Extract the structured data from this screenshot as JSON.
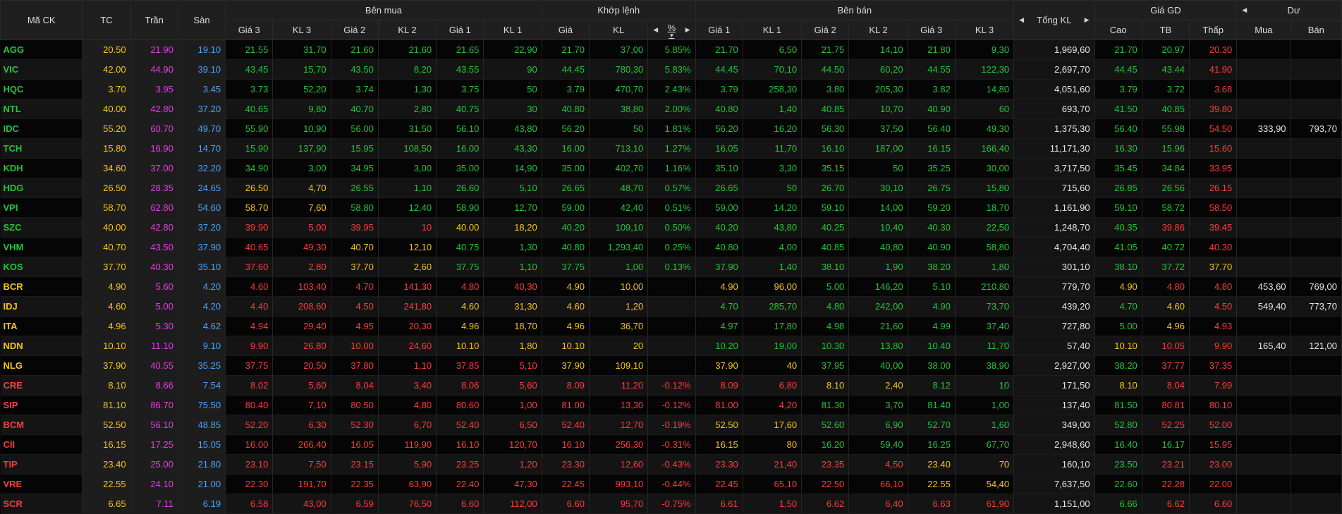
{
  "headers": {
    "symbol": "Mã CK",
    "ref": "TC",
    "ceil": "Trần",
    "floor": "Sàn",
    "buy_group": "Bên mua",
    "match_group": "Khớp lệnh",
    "sell_group": "Bên bán",
    "total_vol": "Tổng KL",
    "price_group": "Giá GD",
    "residual_group": "Dư",
    "buy_cols": [
      "Giá 3",
      "KL 3",
      "Giá 2",
      "KL 2",
      "Giá 1",
      "KL 1"
    ],
    "match_cols": [
      "Giá",
      "KL",
      "%"
    ],
    "sell_cols": [
      "Giá 1",
      "KL 1",
      "Giá 2",
      "KL 2",
      "Giá 3",
      "KL 3"
    ],
    "price_cols": [
      "Cao",
      "TB",
      "Thấp"
    ],
    "residual_cols": [
      "Mua",
      "Bán"
    ]
  },
  "icons": {
    "left": "◀",
    "right": "▶",
    "sort": "▼"
  },
  "colors": {
    "up": "#22c537",
    "down": "#ff3b3b",
    "reference": "#f5c518",
    "ceiling": "#e33fe3",
    "floor": "#4aa3ff"
  },
  "rows": [
    {
      "sym": "AGG",
      "ref": "20.50",
      "ceil": "21.90",
      "floor": "19.10",
      "b3": "21.55",
      "bv3": "31,70",
      "b2": "21.60",
      "bv2": "21,60",
      "b1": "21.65",
      "bv1": "22,90",
      "mp": "21.70",
      "mv": "37,00",
      "pct": "5.85%",
      "s1": "21.70",
      "sv1": "6,50",
      "s2": "21.75",
      "sv2": "14,10",
      "s3": "21.80",
      "sv3": "9,30",
      "tot": "1,969,60",
      "hi": "21.70",
      "avg": "20.97",
      "lo": "20.30",
      "rb": "",
      "rs": ""
    },
    {
      "sym": "VIC",
      "ref": "42.00",
      "ceil": "44.90",
      "floor": "39.10",
      "b3": "43.45",
      "bv3": "15,70",
      "b2": "43.50",
      "bv2": "8,20",
      "b1": "43.55",
      "bv1": "90",
      "mp": "44.45",
      "mv": "780,30",
      "pct": "5.83%",
      "s1": "44.45",
      "sv1": "70,10",
      "s2": "44.50",
      "sv2": "60,20",
      "s3": "44.55",
      "sv3": "122,30",
      "tot": "2,697,70",
      "hi": "44.45",
      "avg": "43.44",
      "lo": "41.90",
      "rb": "",
      "rs": ""
    },
    {
      "sym": "HQC",
      "ref": "3.70",
      "ceil": "3.95",
      "floor": "3.45",
      "b3": "3.73",
      "bv3": "52,20",
      "b2": "3.74",
      "bv2": "1,30",
      "b1": "3.75",
      "bv1": "50",
      "mp": "3.79",
      "mv": "470,70",
      "pct": "2.43%",
      "s1": "3.79",
      "sv1": "258,30",
      "s2": "3.80",
      "sv2": "205,30",
      "s3": "3.82",
      "sv3": "14,80",
      "tot": "4,051,60",
      "hi": "3.79",
      "avg": "3.72",
      "lo": "3.68",
      "rb": "",
      "rs": ""
    },
    {
      "sym": "NTL",
      "ref": "40.00",
      "ceil": "42.80",
      "floor": "37.20",
      "b3": "40.65",
      "bv3": "9,80",
      "b2": "40.70",
      "bv2": "2,80",
      "b1": "40.75",
      "bv1": "30",
      "mp": "40.80",
      "mv": "38,80",
      "pct": "2.00%",
      "s1": "40.80",
      "sv1": "1,40",
      "s2": "40.85",
      "sv2": "10,70",
      "s3": "40.90",
      "sv3": "60",
      "tot": "693,70",
      "hi": "41.50",
      "avg": "40.85",
      "lo": "39.80",
      "rb": "",
      "rs": ""
    },
    {
      "sym": "IDC",
      "ref": "55.20",
      "ceil": "60.70",
      "floor": "49.70",
      "b3": "55.90",
      "bv3": "10,90",
      "b2": "56.00",
      "bv2": "31,50",
      "b1": "56.10",
      "bv1": "43,80",
      "mp": "56.20",
      "mv": "50",
      "pct": "1.81%",
      "s1": "56.20",
      "sv1": "16,20",
      "s2": "56.30",
      "sv2": "37,50",
      "s3": "56.40",
      "sv3": "49,30",
      "tot": "1,375,30",
      "hi": "56.40",
      "avg": "55.98",
      "lo": "54.50",
      "rb": "333,90",
      "rs": "793,70"
    },
    {
      "sym": "TCH",
      "ref": "15.80",
      "ceil": "16.90",
      "floor": "14.70",
      "b3": "15.90",
      "bv3": "137,90",
      "b2": "15.95",
      "bv2": "108,50",
      "b1": "16.00",
      "bv1": "43,30",
      "mp": "16.00",
      "mv": "713,10",
      "pct": "1.27%",
      "s1": "16.05",
      "sv1": "11,70",
      "s2": "16.10",
      "sv2": "187,00",
      "s3": "16.15",
      "sv3": "166,40",
      "tot": "11,171,30",
      "hi": "16.30",
      "avg": "15.96",
      "lo": "15.60",
      "rb": "",
      "rs": ""
    },
    {
      "sym": "KDH",
      "ref": "34.60",
      "ceil": "37.00",
      "floor": "32.20",
      "b3": "34.90",
      "bv3": "3,00",
      "b2": "34.95",
      "bv2": "3,00",
      "b1": "35.00",
      "bv1": "14,90",
      "mp": "35.00",
      "mv": "402,70",
      "pct": "1.16%",
      "s1": "35.10",
      "sv1": "3,30",
      "s2": "35.15",
      "sv2": "50",
      "s3": "35.25",
      "sv3": "30,00",
      "tot": "3,717,50",
      "hi": "35.45",
      "avg": "34.84",
      "lo": "33.95",
      "rb": "",
      "rs": ""
    },
    {
      "sym": "HDG",
      "ref": "26.50",
      "ceil": "28.35",
      "floor": "24.65",
      "b3": "26.50",
      "bv3": "4,70",
      "b2": "26.55",
      "bv2": "1,10",
      "b1": "26.60",
      "bv1": "5,10",
      "mp": "26.65",
      "mv": "48,70",
      "pct": "0.57%",
      "s1": "26.65",
      "sv1": "50",
      "s2": "26.70",
      "sv2": "30,10",
      "s3": "26.75",
      "sv3": "15,80",
      "tot": "715,60",
      "hi": "26.85",
      "avg": "26.56",
      "lo": "26.15",
      "rb": "",
      "rs": ""
    },
    {
      "sym": "VPI",
      "ref": "58.70",
      "ceil": "62.80",
      "floor": "54.60",
      "b3": "58.70",
      "bv3": "7,60",
      "b2": "58.80",
      "bv2": "12,40",
      "b1": "58.90",
      "bv1": "12,70",
      "mp": "59.00",
      "mv": "42,40",
      "pct": "0.51%",
      "s1": "59.00",
      "sv1": "14,20",
      "s2": "59.10",
      "sv2": "14,00",
      "s3": "59.20",
      "sv3": "18,70",
      "tot": "1,161,90",
      "hi": "59.10",
      "avg": "58.72",
      "lo": "58.50",
      "rb": "",
      "rs": ""
    },
    {
      "sym": "SZC",
      "ref": "40.00",
      "ceil": "42.80",
      "floor": "37.20",
      "b3": "39.90",
      "bv3": "5,00",
      "b2": "39.95",
      "bv2": "10",
      "b1": "40.00",
      "bv1": "18,20",
      "mp": "40.20",
      "mv": "109,10",
      "pct": "0.50%",
      "s1": "40.20",
      "sv1": "43,80",
      "s2": "40.25",
      "sv2": "10,40",
      "s3": "40.30",
      "sv3": "22,50",
      "tot": "1,248,70",
      "hi": "40.35",
      "avg": "39.86",
      "lo": "39.45",
      "rb": "",
      "rs": ""
    },
    {
      "sym": "VHM",
      "ref": "40.70",
      "ceil": "43.50",
      "floor": "37.90",
      "b3": "40.65",
      "bv3": "49,30",
      "b2": "40.70",
      "bv2": "12,10",
      "b1": "40.75",
      "bv1": "1,30",
      "mp": "40.80",
      "mv": "1,293,40",
      "pct": "0.25%",
      "s1": "40.80",
      "sv1": "4,00",
      "s2": "40.85",
      "sv2": "40,80",
      "s3": "40.90",
      "sv3": "58,80",
      "tot": "4,704,40",
      "hi": "41.05",
      "avg": "40.72",
      "lo": "40.30",
      "rb": "",
      "rs": ""
    },
    {
      "sym": "KOS",
      "ref": "37.70",
      "ceil": "40.30",
      "floor": "35.10",
      "b3": "37.60",
      "bv3": "2,80",
      "b2": "37.70",
      "bv2": "2,60",
      "b1": "37.75",
      "bv1": "1,10",
      "mp": "37.75",
      "mv": "1,00",
      "pct": "0.13%",
      "s1": "37.90",
      "sv1": "1,40",
      "s2": "38.10",
      "sv2": "1,90",
      "s3": "38.20",
      "sv3": "1,80",
      "tot": "301,10",
      "hi": "38.10",
      "avg": "37.72",
      "lo": "37.70",
      "rb": "",
      "rs": ""
    },
    {
      "sym": "BCR",
      "ref": "4.90",
      "ceil": "5.60",
      "floor": "4.20",
      "b3": "4.60",
      "bv3": "103,40",
      "b2": "4.70",
      "bv2": "141,30",
      "b1": "4.80",
      "bv1": "40,30",
      "mp": "4.90",
      "mv": "10,00",
      "pct": "",
      "s1": "4.90",
      "sv1": "96,00",
      "s2": "5.00",
      "sv2": "146,20",
      "s3": "5.10",
      "sv3": "210,80",
      "tot": "779,70",
      "hi": "4.90",
      "avg": "4.80",
      "lo": "4.80",
      "rb": "453,60",
      "rs": "769,00"
    },
    {
      "sym": "IDJ",
      "ref": "4.60",
      "ceil": "5.00",
      "floor": "4.20",
      "b3": "4.40",
      "bv3": "208,60",
      "b2": "4.50",
      "bv2": "241,80",
      "b1": "4.60",
      "bv1": "31,30",
      "mp": "4.60",
      "mv": "1,20",
      "pct": "",
      "s1": "4.70",
      "sv1": "285,70",
      "s2": "4.80",
      "sv2": "242,00",
      "s3": "4.90",
      "sv3": "73,70",
      "tot": "439,20",
      "hi": "4.70",
      "avg": "4.60",
      "lo": "4.50",
      "rb": "549,40",
      "rs": "773,70"
    },
    {
      "sym": "ITA",
      "ref": "4.96",
      "ceil": "5.30",
      "floor": "4.62",
      "b3": "4.94",
      "bv3": "29,40",
      "b2": "4.95",
      "bv2": "20,30",
      "b1": "4.96",
      "bv1": "18,70",
      "mp": "4.96",
      "mv": "36,70",
      "pct": "",
      "s1": "4.97",
      "sv1": "17,80",
      "s2": "4.98",
      "sv2": "21,60",
      "s3": "4.99",
      "sv3": "37,40",
      "tot": "727,80",
      "hi": "5.00",
      "avg": "4.96",
      "lo": "4.93",
      "rb": "",
      "rs": ""
    },
    {
      "sym": "NDN",
      "ref": "10.10",
      "ceil": "11.10",
      "floor": "9.10",
      "b3": "9.90",
      "bv3": "26,80",
      "b2": "10.00",
      "bv2": "24,60",
      "b1": "10.10",
      "bv1": "1,80",
      "mp": "10.10",
      "mv": "20",
      "pct": "",
      "s1": "10.20",
      "sv1": "19,00",
      "s2": "10.30",
      "sv2": "13,80",
      "s3": "10.40",
      "sv3": "11,70",
      "tot": "57,40",
      "hi": "10.10",
      "avg": "10.05",
      "lo": "9.90",
      "rb": "165,40",
      "rs": "121,00"
    },
    {
      "sym": "NLG",
      "ref": "37.90",
      "ceil": "40.55",
      "floor": "35.25",
      "b3": "37.75",
      "bv3": "20,50",
      "b2": "37.80",
      "bv2": "1,10",
      "b1": "37.85",
      "bv1": "5,10",
      "mp": "37.90",
      "mv": "109,10",
      "pct": "",
      "s1": "37.90",
      "sv1": "40",
      "s2": "37.95",
      "sv2": "40,00",
      "s3": "38.00",
      "sv3": "38,90",
      "tot": "2,927,00",
      "hi": "38.20",
      "avg": "37.77",
      "lo": "37.35",
      "rb": "",
      "rs": ""
    },
    {
      "sym": "CRE",
      "ref": "8.10",
      "ceil": "8.66",
      "floor": "7.54",
      "b3": "8.02",
      "bv3": "5,60",
      "b2": "8.04",
      "bv2": "3,40",
      "b1": "8.06",
      "bv1": "5,60",
      "mp": "8.09",
      "mv": "11,20",
      "pct": "-0.12%",
      "s1": "8.09",
      "sv1": "6,80",
      "s2": "8.10",
      "sv2": "2,40",
      "s3": "8.12",
      "sv3": "10",
      "tot": "171,50",
      "hi": "8.10",
      "avg": "8.04",
      "lo": "7.99",
      "rb": "",
      "rs": ""
    },
    {
      "sym": "SIP",
      "ref": "81.10",
      "ceil": "86.70",
      "floor": "75.50",
      "b3": "80.40",
      "bv3": "7,10",
      "b2": "80.50",
      "bv2": "4,80",
      "b1": "80.60",
      "bv1": "1,00",
      "mp": "81.00",
      "mv": "13,30",
      "pct": "-0.12%",
      "s1": "81.00",
      "sv1": "4,20",
      "s2": "81.30",
      "sv2": "3,70",
      "s3": "81.40",
      "sv3": "1,00",
      "tot": "137,40",
      "hi": "81.50",
      "avg": "80.81",
      "lo": "80.10",
      "rb": "",
      "rs": ""
    },
    {
      "sym": "BCM",
      "ref": "52.50",
      "ceil": "56.10",
      "floor": "48.85",
      "b3": "52.20",
      "bv3": "6,30",
      "b2": "52.30",
      "bv2": "6,70",
      "b1": "52.40",
      "bv1": "6,50",
      "mp": "52.40",
      "mv": "12,70",
      "pct": "-0.19%",
      "s1": "52.50",
      "sv1": "17,60",
      "s2": "52.60",
      "sv2": "6,90",
      "s3": "52.70",
      "sv3": "1,60",
      "tot": "349,00",
      "hi": "52.80",
      "avg": "52.25",
      "lo": "52.00",
      "rb": "",
      "rs": ""
    },
    {
      "sym": "CII",
      "ref": "16.15",
      "ceil": "17.25",
      "floor": "15.05",
      "b3": "16.00",
      "bv3": "266,40",
      "b2": "16.05",
      "bv2": "119,90",
      "b1": "16.10",
      "bv1": "120,70",
      "mp": "16.10",
      "mv": "256,30",
      "pct": "-0.31%",
      "s1": "16.15",
      "sv1": "80",
      "s2": "16.20",
      "sv2": "59,40",
      "s3": "16.25",
      "sv3": "67,70",
      "tot": "2,948,60",
      "hi": "16.40",
      "avg": "16.17",
      "lo": "15.95",
      "rb": "",
      "rs": ""
    },
    {
      "sym": "TIP",
      "ref": "23.40",
      "ceil": "25.00",
      "floor": "21.80",
      "b3": "23.10",
      "bv3": "7,50",
      "b2": "23.15",
      "bv2": "5,90",
      "b1": "23.25",
      "bv1": "1,20",
      "mp": "23.30",
      "mv": "12,60",
      "pct": "-0.43%",
      "s1": "23.30",
      "sv1": "21,40",
      "s2": "23.35",
      "sv2": "4,50",
      "s3": "23.40",
      "sv3": "70",
      "tot": "160,10",
      "hi": "23.50",
      "avg": "23.21",
      "lo": "23.00",
      "rb": "",
      "rs": ""
    },
    {
      "sym": "VRE",
      "ref": "22.55",
      "ceil": "24.10",
      "floor": "21.00",
      "b3": "22.30",
      "bv3": "191,70",
      "b2": "22.35",
      "bv2": "63,90",
      "b1": "22.40",
      "bv1": "47,30",
      "mp": "22.45",
      "mv": "993,10",
      "pct": "-0.44%",
      "s1": "22.45",
      "sv1": "65,10",
      "s2": "22.50",
      "sv2": "66,10",
      "s3": "22.55",
      "sv3": "54,40",
      "tot": "7,637,50",
      "hi": "22.60",
      "avg": "22.28",
      "lo": "22.00",
      "rb": "",
      "rs": ""
    },
    {
      "sym": "SCR",
      "ref": "6.65",
      "ceil": "7.11",
      "floor": "6.19",
      "b3": "6.58",
      "bv3": "43,00",
      "b2": "6.59",
      "bv2": "76,50",
      "b1": "6.60",
      "bv1": "112,00",
      "mp": "6.60",
      "mv": "95,70",
      "pct": "-0.75%",
      "s1": "6.61",
      "sv1": "1,50",
      "s2": "6.62",
      "sv2": "6,40",
      "s3": "6.63",
      "sv3": "61,90",
      "tot": "1,151,00",
      "hi": "6.66",
      "avg": "6.62",
      "lo": "6.60",
      "rb": "",
      "rs": ""
    }
  ]
}
